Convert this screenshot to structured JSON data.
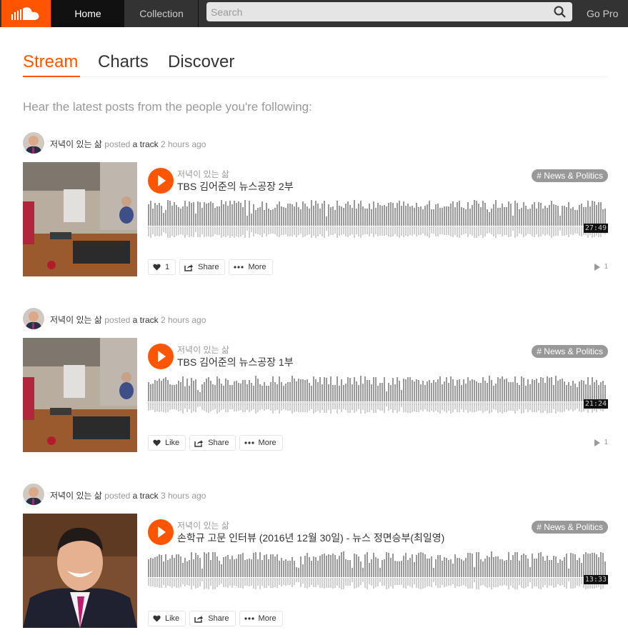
{
  "header": {
    "logo_icon": "soundcloud-logo-icon",
    "nav_home": "Home",
    "nav_collection": "Collection",
    "search_placeholder": "Search",
    "go_pro": "Go Pro"
  },
  "tabs": [
    {
      "label": "Stream",
      "active": true
    },
    {
      "label": "Charts",
      "active": false
    },
    {
      "label": "Discover",
      "active": false
    }
  ],
  "intro": "Hear the latest posts from the people you're following:",
  "accent_color": "#ff5500",
  "stream": [
    {
      "poster": "저녁이 있는 삶",
      "action": "posted",
      "object": "a track",
      "time": "2 hours ago",
      "uploader": "저녁이 있는 삶",
      "title": "TBS 김어준의 뉴스공장 2부",
      "tag": "# News & Politics",
      "duration": "27:49",
      "like_label": "1",
      "share_label": "Share",
      "more_label": "More",
      "play_count": "1"
    },
    {
      "poster": "저녁이 있는 삶",
      "action": "posted",
      "object": "a track",
      "time": "2 hours ago",
      "uploader": "저녁이 있는 삶",
      "title": "TBS 김어준의 뉴스공장 1부",
      "tag": "# News & Politics",
      "duration": "21:24",
      "like_label": "Like",
      "share_label": "Share",
      "more_label": "More",
      "play_count": "1"
    },
    {
      "poster": "저녁이 있는 삶",
      "action": "posted",
      "object": "a track",
      "time": "3 hours ago",
      "uploader": "저녁이 있는 삶",
      "title": "손학규 고문 인터뷰 (2016년 12월 30일) - 뉴스 정면승부(최일영)",
      "tag": "# News & Politics",
      "duration": "13:33",
      "like_label": "Like",
      "share_label": "Share",
      "more_label": "More"
    }
  ]
}
